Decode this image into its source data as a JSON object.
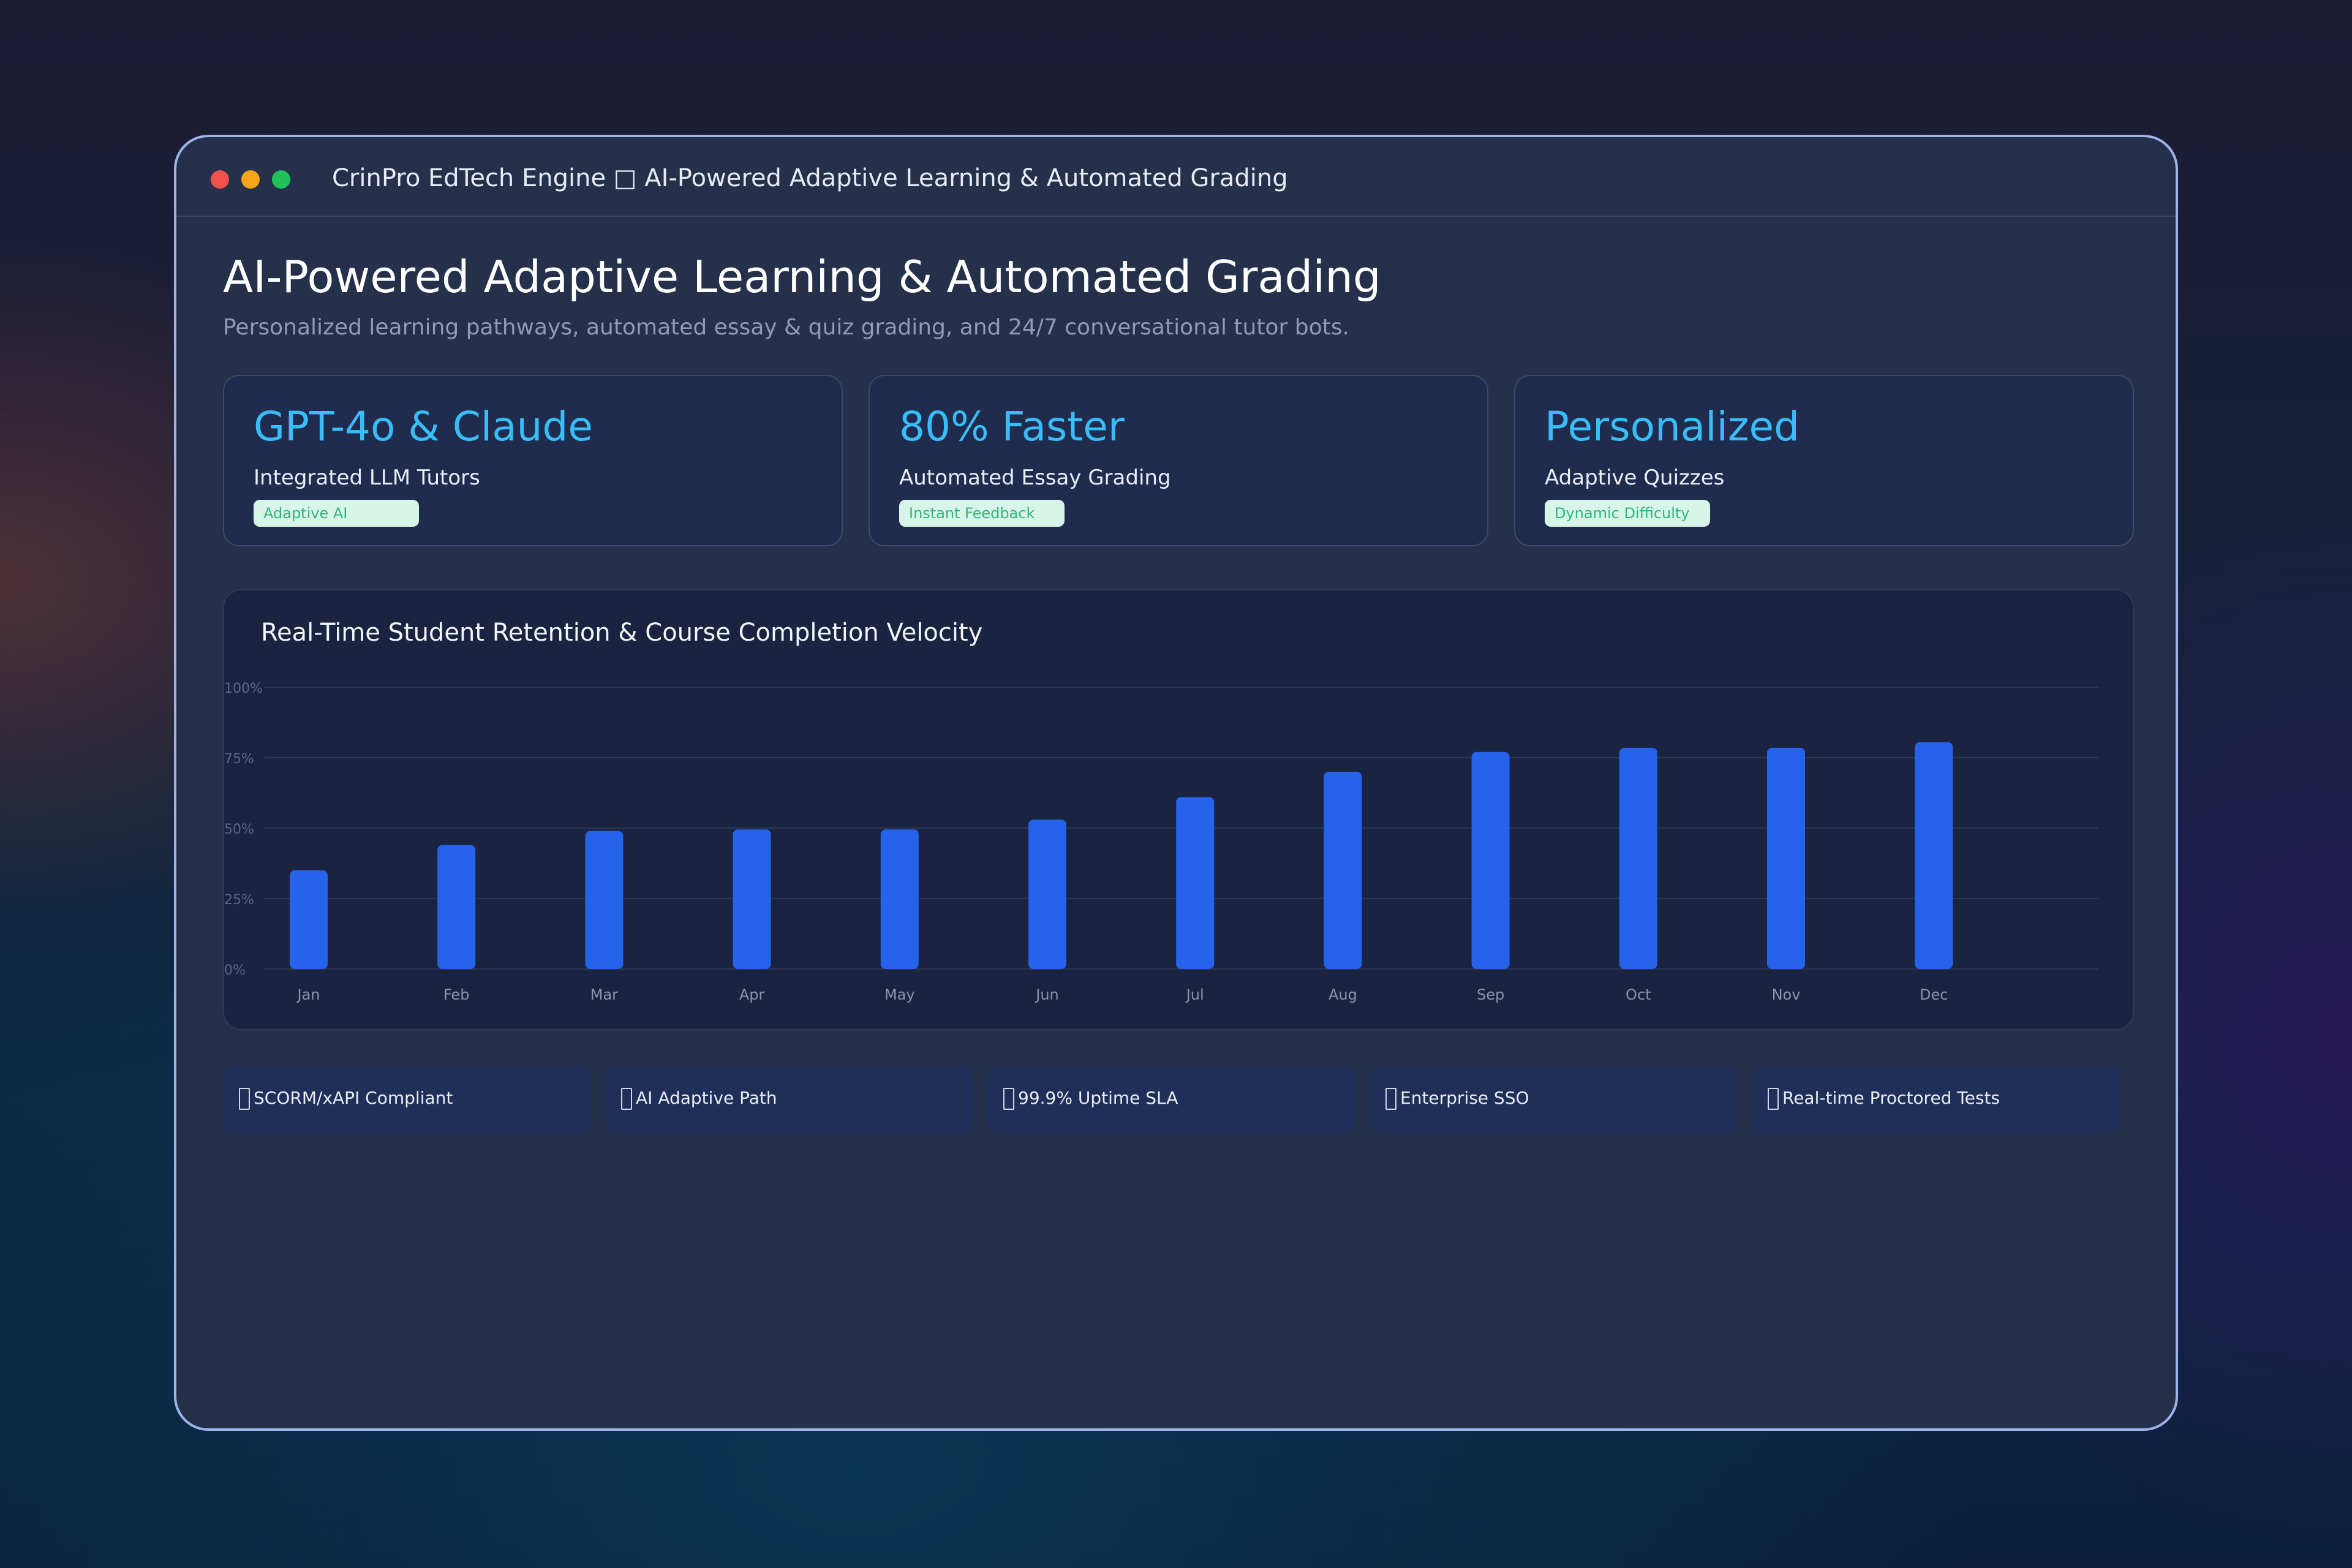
{
  "window": {
    "title": "CrinPro EdTech Engine □ AI-Powered Adaptive Learning & Automated Grading"
  },
  "header": {
    "title": "AI-Powered Adaptive Learning & Automated Grading",
    "subtitle": "Personalized learning pathways, automated essay & quiz grading, and 24/7 conversational tutor bots."
  },
  "cards": [
    {
      "value": "GPT-4o & Claude",
      "label": "Integrated LLM Tutors",
      "badge": "Adaptive AI"
    },
    {
      "value": "80% Faster",
      "label": "Automated Essay Grading",
      "badge": "Instant Feedback"
    },
    {
      "value": "Personalized",
      "label": "Adaptive Quizzes",
      "badge": "Dynamic Difficulty"
    }
  ],
  "chart": {
    "title": "Real-Time Student Retention & Course Completion Velocity"
  },
  "chart_data": {
    "type": "bar",
    "title": "Real-Time Student Retention & Course Completion Velocity",
    "categories": [
      "Jan",
      "Feb",
      "Mar",
      "Apr",
      "May",
      "Jun",
      "Jul",
      "Aug",
      "Sep",
      "Oct",
      "Nov",
      "Dec"
    ],
    "values": [
      35,
      44,
      49,
      49.5,
      49.5,
      53,
      61,
      70,
      77,
      78.5,
      78.5,
      80.5
    ],
    "ylim": [
      0,
      100
    ],
    "yticks": [
      "0%",
      "25%",
      "50%",
      "75%",
      "100%"
    ],
    "ytick_values": [
      0,
      25,
      50,
      75,
      100
    ],
    "grid": true,
    "bar_color": "#2563eb"
  },
  "features": [
    {
      "icon": "missing-glyph-icon",
      "label": "SCORM/xAPI Compliant"
    },
    {
      "icon": "missing-glyph-icon",
      "label": "AI Adaptive Path"
    },
    {
      "icon": "missing-glyph-icon",
      "label": "99.9% Uptime SLA"
    },
    {
      "icon": "missing-glyph-icon",
      "label": "Enterprise SSO"
    },
    {
      "icon": "missing-glyph-icon",
      "label": "Real-time Proctored Tests"
    }
  ],
  "colors": {
    "accent": "#38bdf8",
    "badge_bg": "#d8f5e9",
    "badge_text": "#2fb77a",
    "window_border": "#9fb3ea"
  }
}
